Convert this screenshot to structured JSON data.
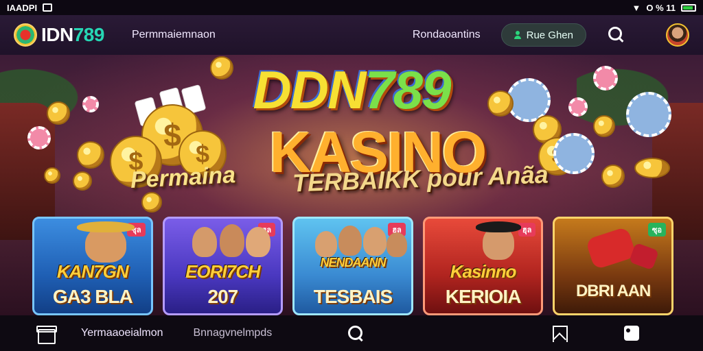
{
  "status_bar": {
    "left_text": "IAADPI",
    "right_text": "O % 11"
  },
  "header": {
    "logo_primary": "IDN",
    "logo_secondary": "789",
    "nav_link": "Permmaiemnaon",
    "nav_right_link": "Rondaoantins",
    "login_label": "Rue Ghen",
    "accent_color": "#26d6b4",
    "login_icon_color": "#2bd67b"
  },
  "hero": {
    "title_primary": "DDN",
    "title_secondary": "789",
    "title_main": "KASINO",
    "tagline_left": "Permaina",
    "tagline_right": "TERBAIKK pour Anãa"
  },
  "games": [
    {
      "badge": "ซุล",
      "line1": "KAN7GN",
      "line2": "GA3 BLA"
    },
    {
      "badge": "ฮุล",
      "line1": "EORI7CH",
      "line2": "207"
    },
    {
      "badge": "ฮุล",
      "line1": "NENDAANN",
      "line2": "TESBAIS"
    },
    {
      "badge": "ฮุล",
      "line1": "Kasinno",
      "line2": "KERIOIA"
    },
    {
      "badge": "ซุอ",
      "line1": "",
      "line2": "DBRI AAN"
    }
  ],
  "bottom_nav": {
    "item1_label": "Yermaaoeialmon",
    "item2_label": "Bnnagvnelmpds"
  }
}
